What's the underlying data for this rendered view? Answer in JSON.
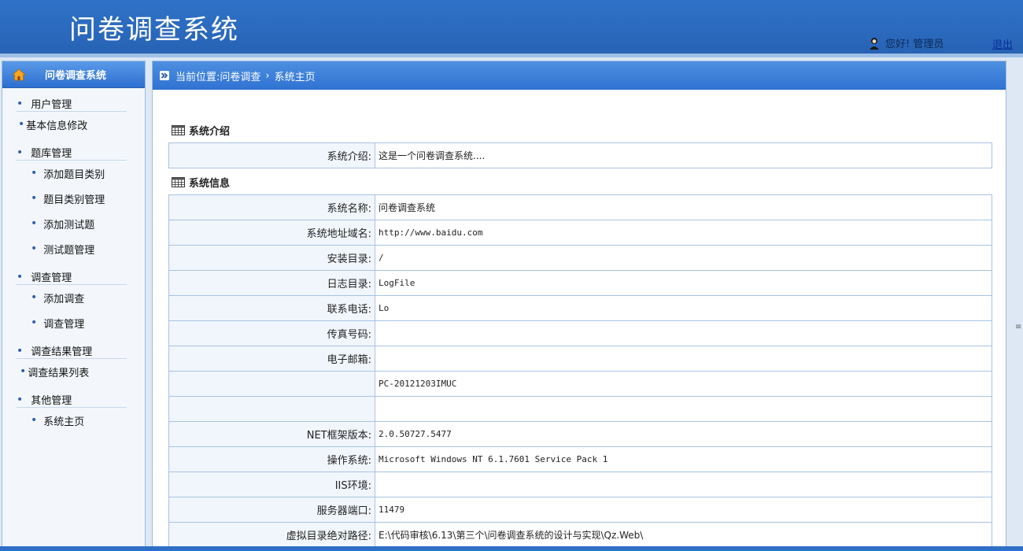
{
  "header": {
    "title": "问卷调查系统",
    "greeting": "您好! 管理员",
    "logout": "退出"
  },
  "sidebar": {
    "title": "问卷调查系统",
    "groups": [
      {
        "title": "用户管理",
        "items": [
          "基本信息修改"
        ]
      },
      {
        "title": "题库管理",
        "items": [
          "添加题目类别",
          "题目类别管理",
          "添加测试题",
          "测试题管理"
        ]
      },
      {
        "title": "调查管理",
        "items": [
          "添加调查",
          "调查管理"
        ]
      },
      {
        "title": "调查结果管理",
        "items": [
          "调查结果列表"
        ]
      },
      {
        "title": "其他管理",
        "items": [
          "系统主页"
        ]
      }
    ]
  },
  "breadcrumb": {
    "prefix": "当前位置: ",
    "parent": "问卷调查",
    "separator": "›",
    "current": "系统主页"
  },
  "intro": {
    "title": "系统介绍",
    "rows": [
      {
        "label": "系统介绍:",
        "value": "这是一个问卷调查系统...."
      }
    ]
  },
  "sysinfo": {
    "title": "系统信息",
    "rows": [
      {
        "label": "系统名称:",
        "value": "问卷调查系统"
      },
      {
        "label": "系统地址域名:",
        "value": "http://www.baidu.com"
      },
      {
        "label": "安装目录:",
        "value": "/"
      },
      {
        "label": "日志目录:",
        "value": "LogFile"
      },
      {
        "label": "联系电话:",
        "value": "Lo"
      },
      {
        "label": "传真号码:",
        "value": ""
      },
      {
        "label": "电子邮箱:",
        "value": ""
      },
      {
        "label": "",
        "value": "PC-20121203IMUC"
      },
      {
        "label": "",
        "value": ""
      },
      {
        "label": "NET框架版本:",
        "value": "2.0.50727.5477"
      },
      {
        "label": "操作系统:",
        "value": "Microsoft Windows NT 6.1.7601 Service Pack 1"
      },
      {
        "label": "IIS环境:",
        "value": ""
      },
      {
        "label": "服务器端口:",
        "value": "11479"
      },
      {
        "label": "虚拟目录绝对路径:",
        "value": "E:\\代码审核\\6.13\\第三个\\问卷调查系统的设计与实现\\Qz.Web\\"
      }
    ]
  },
  "colors": {
    "header": "#2b69bd",
    "accent": "#2f72d2",
    "border": "#a8c3e2"
  }
}
